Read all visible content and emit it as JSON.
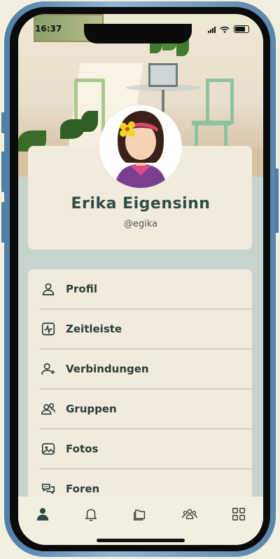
{
  "status_bar": {
    "time": "16:37"
  },
  "profile": {
    "name": "Erika Eigensinn",
    "handle": "@egika"
  },
  "menu": {
    "items": [
      {
        "label": "Profil",
        "icon": "user-icon"
      },
      {
        "label": "Zeitleiste",
        "icon": "activity-icon"
      },
      {
        "label": "Verbindungen",
        "icon": "user-plus-icon"
      },
      {
        "label": "Gruppen",
        "icon": "users-icon"
      },
      {
        "label": "Fotos",
        "icon": "image-icon"
      },
      {
        "label": "Foren",
        "icon": "chat-bubbles-icon"
      }
    ]
  },
  "tabbar": {
    "tabs": [
      {
        "icon": "person-icon",
        "active": true
      },
      {
        "icon": "bell-icon",
        "active": false
      },
      {
        "icon": "folders-icon",
        "active": false
      },
      {
        "icon": "group-icon",
        "active": false
      },
      {
        "icon": "grid-icon",
        "active": false
      }
    ]
  },
  "colors": {
    "accent": "#2e4d45",
    "card": "#f0ebdc",
    "background": "#c7d4cd",
    "frame": "#4f7ea6"
  }
}
